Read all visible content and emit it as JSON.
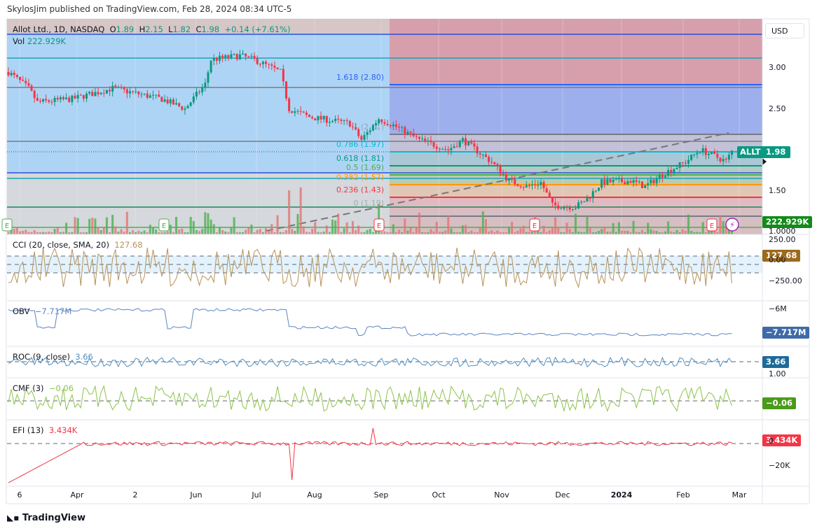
{
  "header": {
    "published": "SkylosJim published on TradingView.com, Feb 28, 2024 08:34 UTC-5"
  },
  "symbol": {
    "name": "Allot Ltd., 1D, NASDAQ",
    "o_label": "O",
    "o": "1.89",
    "h_label": "H",
    "h": "2.15",
    "l_label": "L",
    "l": "1.82",
    "c_label": "C",
    "c": "1.98",
    "change": "+0.14 (+7.61%)",
    "vol_label": "Vol",
    "vol": "222.929K",
    "ticker": "ALLT"
  },
  "price_axis": {
    "currency": "USD",
    "ticks": [
      "3.00",
      "2.50",
      "1.50",
      "1.0000"
    ],
    "last_price": "1.98",
    "last_volume": "222.929K"
  },
  "fib_levels": [
    {
      "label": "1.618 (2.80)",
      "color": "#2962ff"
    },
    {
      "label": "1 (2.11)",
      "color": "#787b86"
    },
    {
      "label": "0.786 (1.97)",
      "color": "#00bcd4"
    },
    {
      "label": "0.618 (1.81)",
      "color": "#089981"
    },
    {
      "label": "0.5 (1.69)",
      "color": "#4caf50"
    },
    {
      "label": "0.382 (1.57)",
      "color": "#ff9800"
    },
    {
      "label": "0.236 (1.43)",
      "color": "#f23645"
    },
    {
      "label": "0 (1.19)",
      "color": "#787b86"
    }
  ],
  "earnings_marker": "E",
  "indicators": [
    {
      "name": "CCI (20, close, SMA, 20)",
      "value": "127.68",
      "color": "#b7925a",
      "tag_color": "#9c6a1c",
      "ticks": [
        "250.00",
        "0.00",
        "−250.00"
      ]
    },
    {
      "name": "OBV",
      "value": "−7.717M",
      "color": "#5b84c4",
      "tag_color": "#3e6aa8",
      "ticks": [
        "−6M"
      ]
    },
    {
      "name": "ROC (9, close)",
      "value": "3.66",
      "color": "#4f8fc4",
      "tag_color": "#1f6a99",
      "ticks": []
    },
    {
      "name": "CMF (3)",
      "value": "−0.06",
      "color": "#8bc34a",
      "tag_color": "#4b9b1a",
      "ticks": [
        "1.00"
      ]
    },
    {
      "name": "EFI (13)",
      "value": "3.434K",
      "color": "#f23645",
      "tag_color": "#f23645",
      "ticks": [
        "0",
        "−20K"
      ]
    }
  ],
  "time_axis": [
    "6",
    "Apr",
    "2",
    "Jun",
    "Jul",
    "Aug",
    "Sep",
    "Oct",
    "Nov",
    "Dec",
    "2024",
    "Feb",
    "Mar"
  ],
  "footer": {
    "brand": "TradingView"
  },
  "chart_data": {
    "type": "candlestick",
    "close_anchors": [
      [
        0,
        2.95
      ],
      [
        7,
        2.75
      ],
      [
        10,
        2.58
      ],
      [
        22,
        2.62
      ],
      [
        36,
        2.75
      ],
      [
        53,
        2.62
      ],
      [
        61,
        2.5
      ],
      [
        68,
        2.8
      ],
      [
        70,
        3.1
      ],
      [
        80,
        3.15
      ],
      [
        85,
        3.1
      ],
      [
        94,
        2.95
      ],
      [
        97,
        2.5
      ],
      [
        104,
        2.4
      ],
      [
        118,
        2.32
      ],
      [
        122,
        2.12
      ],
      [
        128,
        2.38
      ],
      [
        133,
        2.3
      ],
      [
        142,
        2.12
      ],
      [
        152,
        2.0
      ],
      [
        157,
        2.12
      ],
      [
        167,
        1.85
      ],
      [
        173,
        1.62
      ],
      [
        179,
        1.55
      ],
      [
        184,
        1.6
      ],
      [
        188,
        1.32
      ],
      [
        196,
        1.3
      ],
      [
        200,
        1.4
      ],
      [
        205,
        1.6
      ],
      [
        215,
        1.62
      ],
      [
        220,
        1.55
      ],
      [
        227,
        1.72
      ],
      [
        234,
        1.85
      ],
      [
        239,
        2.0
      ],
      [
        248,
        1.86
      ],
      [
        250,
        1.98
      ]
    ]
  }
}
